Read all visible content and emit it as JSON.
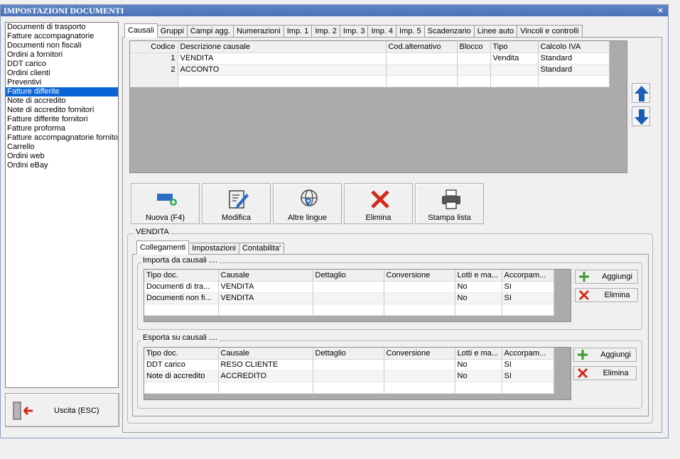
{
  "window": {
    "title": "IMPOSTAZIONI DOCUMENTI",
    "close": "×"
  },
  "doc_types": [
    "Documenti di trasporto",
    "Fatture accompagnatorie",
    "Documenti non fiscali",
    "Ordini a fornitori",
    "DDT carico",
    "Ordini clienti",
    "Preventivi",
    "Fatture differite",
    "Note di accredito",
    "Note di accredito fornitori",
    "Fatture differite fornitori",
    "Fatture proforma",
    "Fatture accompagnatorie fornito",
    "Carrello",
    "Ordini web",
    "Ordini eBay"
  ],
  "selected_doc_type": "Fatture differite",
  "exit_button": "Uscita (ESC)",
  "tabs": [
    "Causali",
    "Gruppi",
    "Campi agg.",
    "Numerazioni",
    "Imp. 1",
    "Imp. 2",
    "Imp. 3",
    "Imp. 4",
    "Imp. 5",
    "Scadenzario",
    "Linee auto",
    "Vincoli e controlli"
  ],
  "active_tab": "Causali",
  "causali_grid": {
    "headers": [
      "Codice",
      "Descrizione causale",
      "Cod.alternativo",
      "Blocco",
      "Tipo",
      "Calcolo IVA"
    ],
    "rows": [
      [
        "1",
        "VENDITA",
        "",
        "",
        "Vendita",
        "Standard"
      ],
      [
        "2",
        "ACCONTO",
        "",
        "",
        "",
        "Standard"
      ],
      [
        "",
        "",
        "",
        "",
        "",
        ""
      ]
    ]
  },
  "actions": {
    "new": "Nuova (F4)",
    "edit": "Modifica",
    "languages": "Altre lingue",
    "delete": "Elimina",
    "print": "Stampa lista"
  },
  "detail_group_title": "VENDITA",
  "subtabs": [
    "Collegamenti",
    "Impostazioni",
    "Contabilita'"
  ],
  "active_subtab": "Collegamenti",
  "import_group": {
    "title": "Importa da causali ....",
    "headers": [
      "Tipo doc.",
      "Causale",
      "Dettaglio",
      "Conversione",
      "Lotti e ma...",
      "Accorpam..."
    ],
    "rows": [
      [
        "Documenti di tra...",
        "VENDITA",
        "",
        "",
        "No",
        "SI"
      ],
      [
        "Documenti non fi...",
        "VENDITA",
        "",
        "",
        "No",
        "SI"
      ],
      [
        "",
        "",
        "",
        "",
        "",
        ""
      ]
    ],
    "add": "Aggiungi",
    "delete": "Elimina"
  },
  "export_group": {
    "title": "Esporta su causali ....",
    "headers": [
      "Tipo doc.",
      "Causale",
      "Dettaglio",
      "Conversione",
      "Lotti e ma...",
      "Accorpam..."
    ],
    "rows": [
      [
        "DDT carico",
        "RESO CLIENTE",
        "",
        "",
        "No",
        "SI"
      ],
      [
        "Note di accredito",
        "ACCREDITO",
        "",
        "",
        "No",
        "SI"
      ],
      [
        "",
        "",
        "",
        "",
        "",
        ""
      ]
    ],
    "add": "Aggiungi",
    "delete": "Elimina"
  },
  "colors": {
    "title_bar": "#4a72b6",
    "selection": "#0a64d6",
    "arrow": "#1a5fb4",
    "delete_red": "#d42a1a",
    "add_green": "#3a9a2a"
  }
}
